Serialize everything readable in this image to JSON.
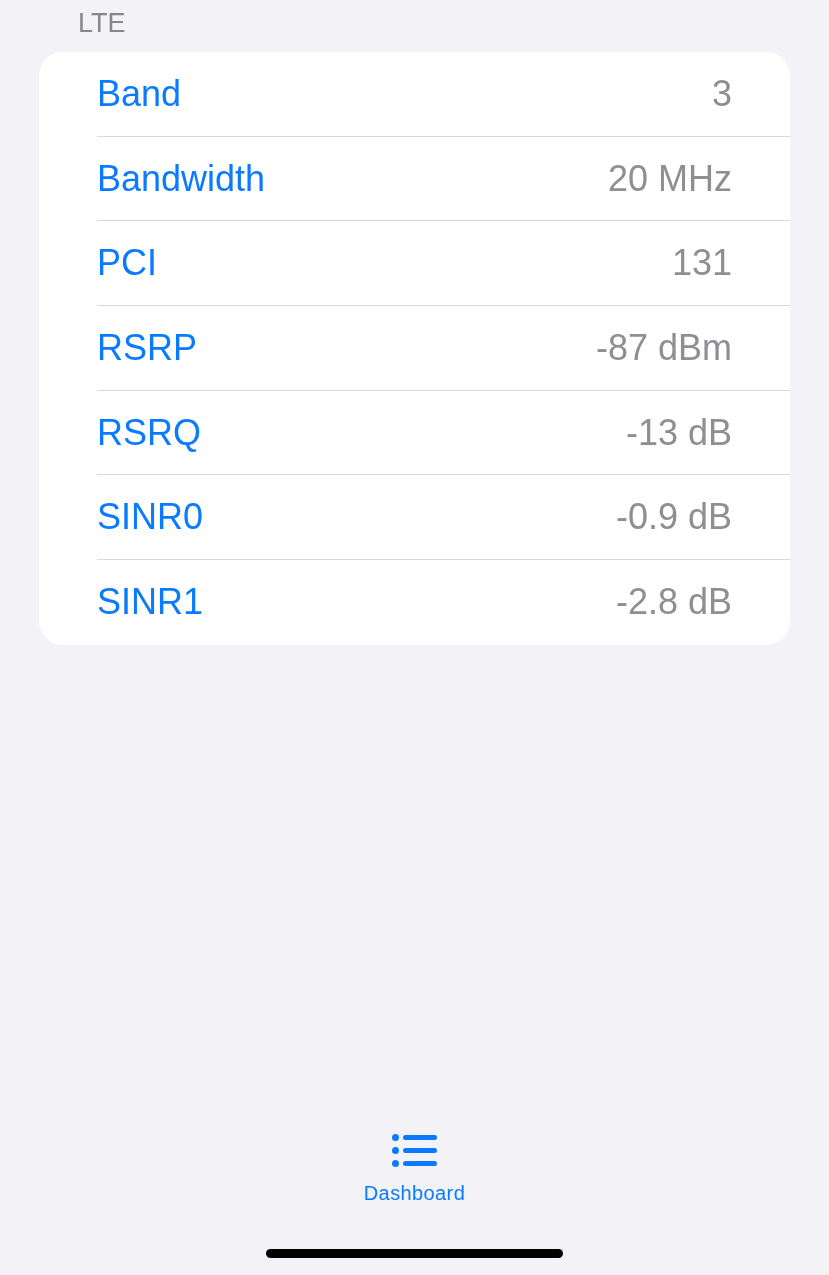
{
  "section": {
    "title": "LTE"
  },
  "rows": [
    {
      "label": "Band",
      "value": "3"
    },
    {
      "label": "Bandwidth",
      "value": "20 MHz"
    },
    {
      "label": "PCI",
      "value": "131"
    },
    {
      "label": "RSRP",
      "value": "-87 dBm"
    },
    {
      "label": "RSRQ",
      "value": "-13 dB"
    },
    {
      "label": "SINR0",
      "value": "-0.9 dB"
    },
    {
      "label": "SINR1",
      "value": "-2.8 dB"
    }
  ],
  "tab_bar": {
    "tabs": [
      {
        "label": "Dashboard",
        "selected": true
      }
    ]
  }
}
